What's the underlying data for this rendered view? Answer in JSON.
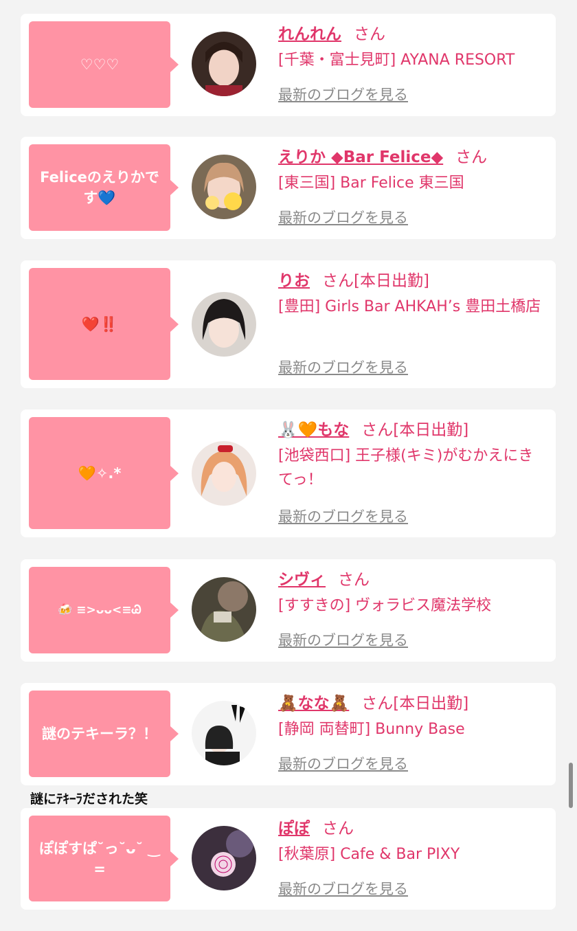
{
  "suffix": "さん",
  "blog_label": "最新のブログを見る",
  "items": [
    {
      "message": "♡♡♡",
      "name": "れんれん",
      "status": "",
      "shop": "[千葉・富士見町] AYANA RESORT"
    },
    {
      "message": "Feliceのえりかです💙",
      "name": "えりか ◆Bar Felice◆",
      "status": "",
      "shop": "[東三国] Bar Felice 東三国"
    },
    {
      "message": "❤️‼️",
      "name": "りお",
      "status": "[本日出勤]",
      "shop": "[豊田] Girls Bar AHKAH’s 豊田土橋店"
    },
    {
      "message": "🧡✧.*",
      "name": "🐰🧡もな",
      "status": "[本日出勤]",
      "shop": "[池袋西口] 王子様(キミ)がむかえにきてっ！"
    },
    {
      "message": "🍻 ≡>ᴗᴗ<≡Ꮚ",
      "name": "シヴィ",
      "status": "",
      "shop": "[すすきの] ヴォラビス魔法学校"
    },
    {
      "message": "謎のテキーラ？！",
      "name": "🧸なな🧸",
      "status": "[本日出勤]",
      "shop": "[静岡 両替町] Bunny Base"
    },
    {
      "message": "ぽぽすぱ˘っ˘ᴗ˘ ‿ =",
      "name": "ぽぽ",
      "status": "",
      "shop": "[秋葉原] Cafe & Bar PIXY"
    }
  ],
  "caption": "謎にﾃｷｰﾗだされた笑",
  "colors": {
    "accent": "#e0366a",
    "bubble": "#ff93a4",
    "link": "#8a8a8a"
  }
}
